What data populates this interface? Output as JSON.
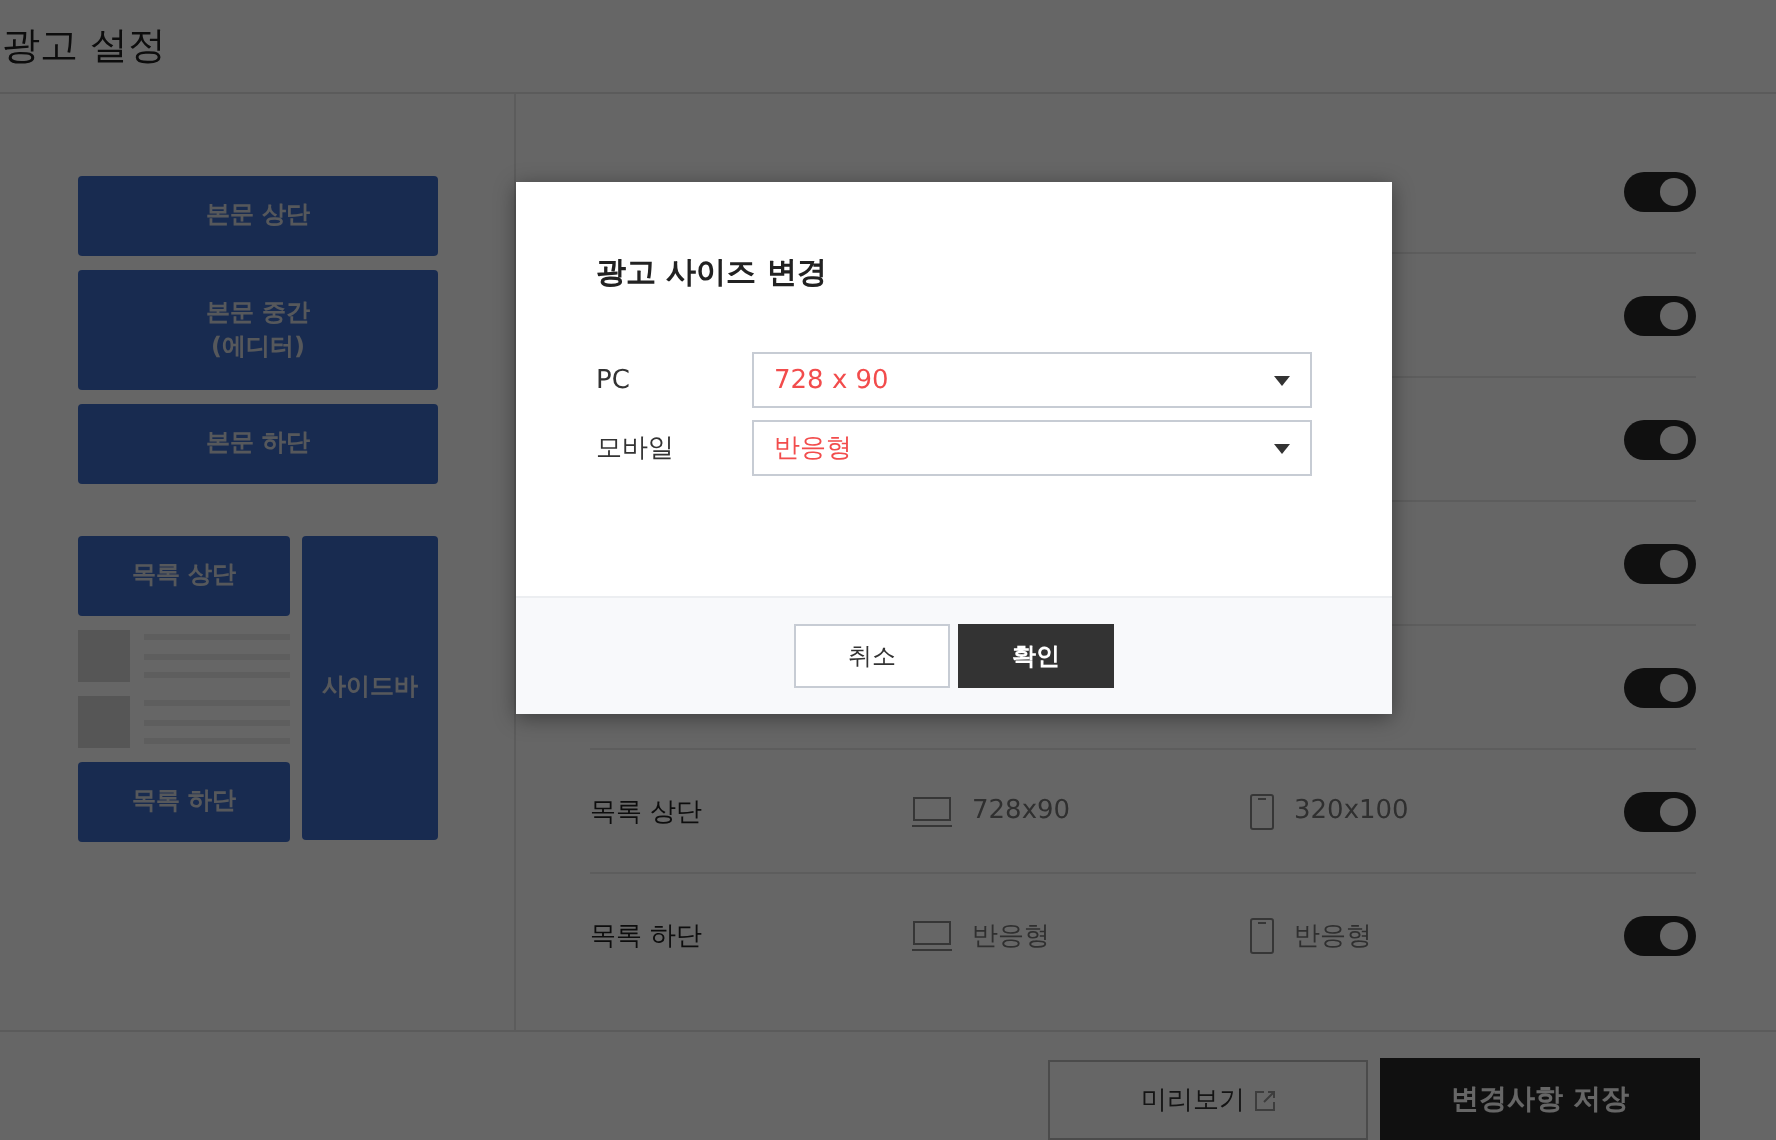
{
  "page_title": "광고 설정",
  "layout_preview": {
    "blocks": [
      {
        "kind": "wide",
        "label": "본문 상단"
      },
      {
        "kind": "tall2",
        "label": "본문 중간\n(에디터)"
      },
      {
        "kind": "wide",
        "label": "본문 하단"
      }
    ],
    "list_top": "목록 상단",
    "list_bottom": "목록 하단",
    "sidebar": "사이드바"
  },
  "ad_rows": [
    {
      "on": true
    },
    {
      "on": true
    },
    {
      "on": true
    },
    {
      "on": true
    },
    {
      "on": true
    },
    {
      "label": "목록 상단",
      "pc": "728x90",
      "mobile": "320x100",
      "on": true
    },
    {
      "label": "목록 하단",
      "pc": "반응형",
      "mobile": "반응형",
      "on": true
    }
  ],
  "footer": {
    "preview": "미리보기",
    "save": "변경사항 저장"
  },
  "dialog": {
    "title": "광고 사이즈 변경",
    "fields": [
      {
        "label": "PC",
        "value": "728 x 90"
      },
      {
        "label": "모바일",
        "value": "반응형"
      }
    ],
    "cancel": "취소",
    "confirm": "확인"
  }
}
